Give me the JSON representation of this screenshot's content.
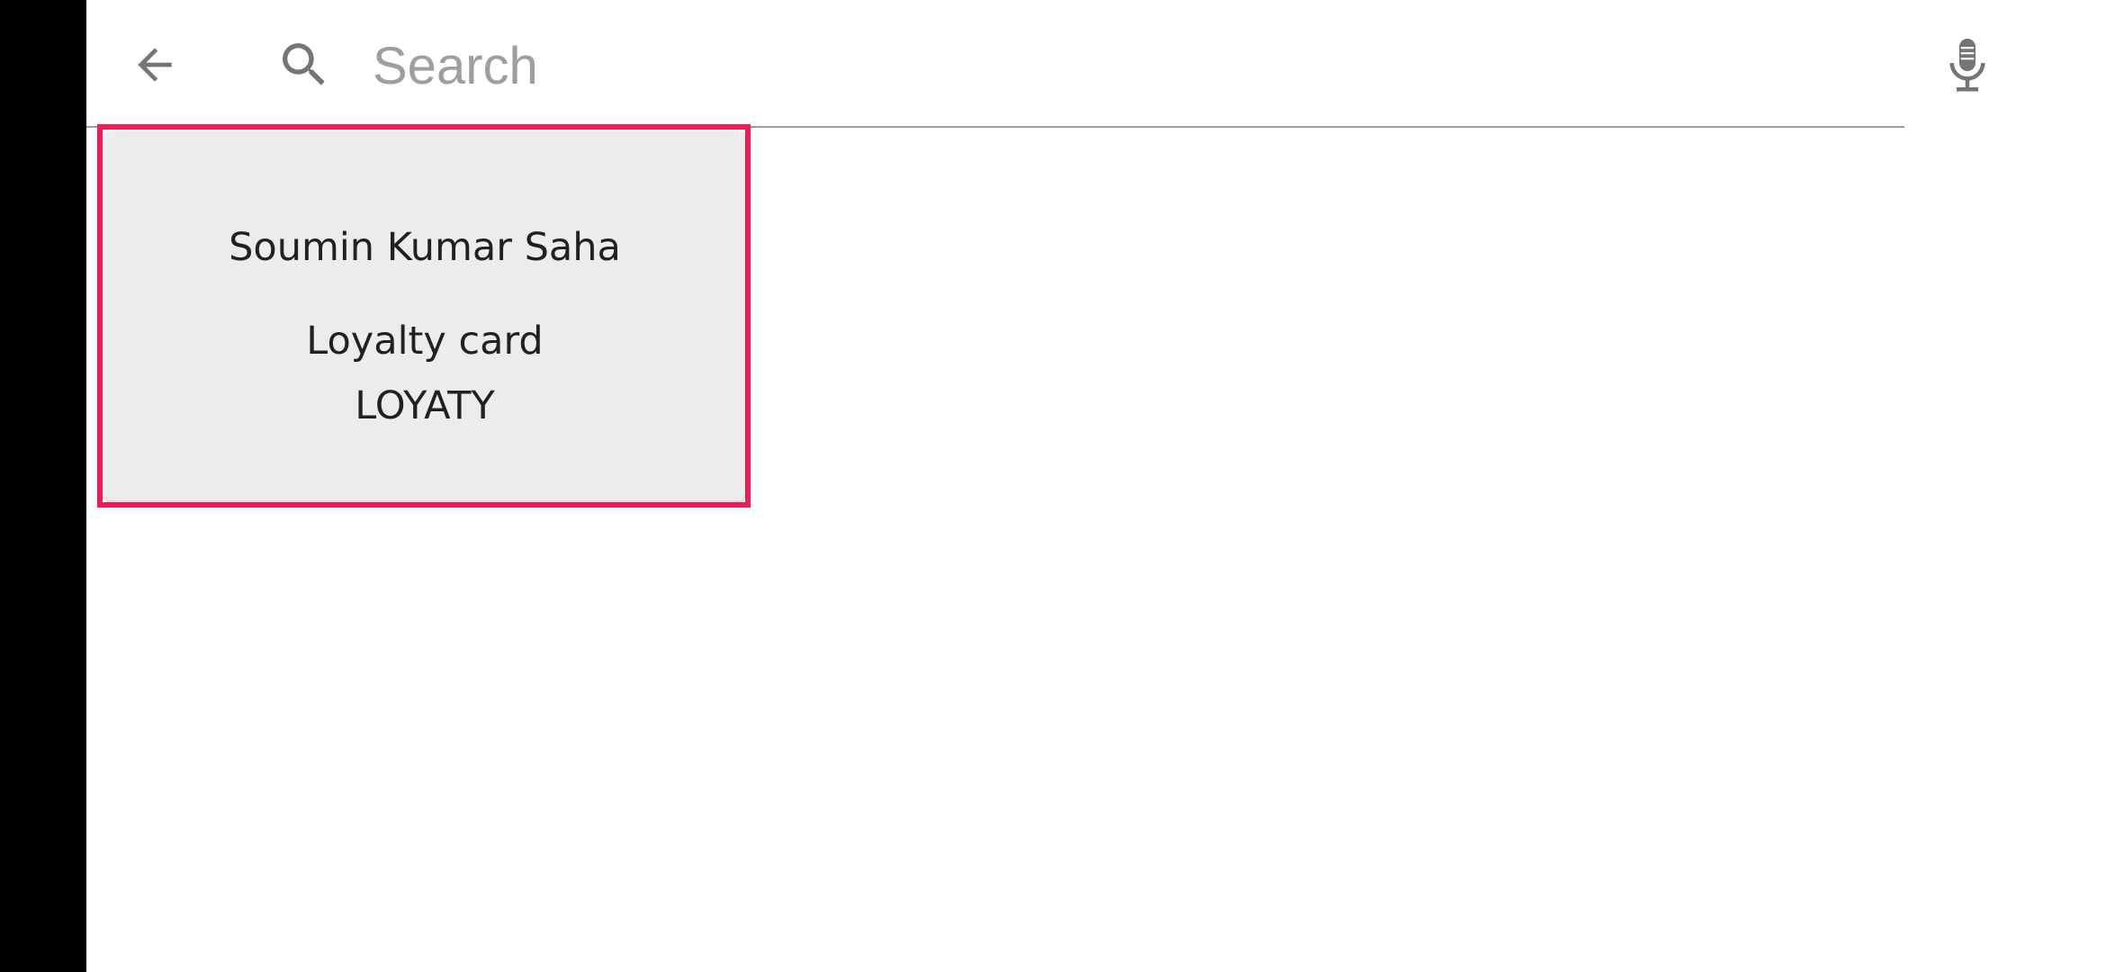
{
  "search": {
    "placeholder": "Search",
    "value": ""
  },
  "icons": {
    "back": "arrow-left-icon",
    "search": "search-icon",
    "mic": "microphone-icon"
  },
  "colors": {
    "highlight": "#ee1d58",
    "card_bg": "#ececec",
    "icon": "#757575"
  },
  "results": [
    {
      "name": "Soumin Kumar Saha",
      "type": "Loyalty card",
      "code": "LOYATY"
    }
  ]
}
